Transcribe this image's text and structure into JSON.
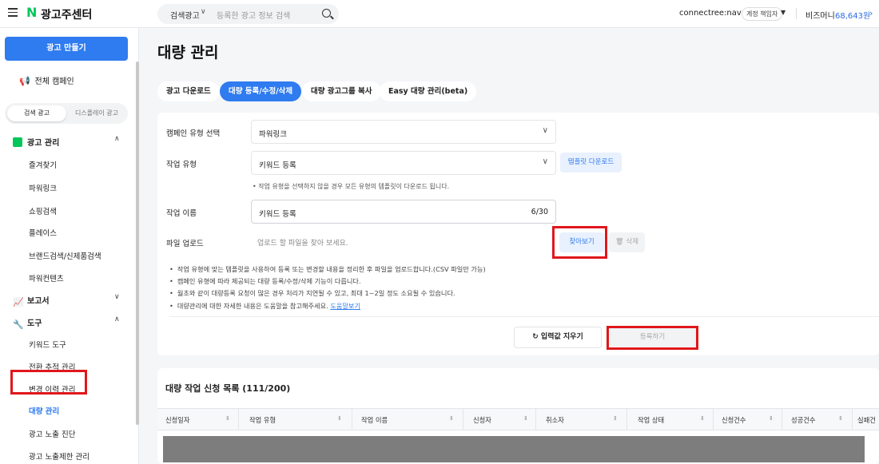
{
  "topbar": {
    "brand": "광고주센터",
    "search_type": "검색광고",
    "search_placeholder": "등록한 광고 정보 검색",
    "account": "connectree:naver",
    "account_role": "계정 책임자",
    "bizmoney_label": "비즈머니",
    "bizmoney_value": "68,643원"
  },
  "sidebar": {
    "create_label": "광고 만들기",
    "all_campaigns": "전체 캠페인",
    "seg_search": "검색 광고",
    "seg_display": "디스플레이 광고",
    "group_ads": "광고 관리",
    "ads_items": [
      "즐겨찾기",
      "파워링크",
      "쇼핑검색",
      "플레이스",
      "브랜드검색/신제품검색",
      "파워컨텐츠"
    ],
    "group_report": "보고서",
    "group_tools": "도구",
    "tools_items": [
      "키워드 도구",
      "전환 추적 관리",
      "변경 이력 관리",
      "대량 관리",
      "광고 노출 진단",
      "광고 노출제한 관리"
    ]
  },
  "main": {
    "title": "대량 관리",
    "tabs": [
      "광고 다운로드",
      "대량 등록/수정/삭제",
      "대량 광고그룹 복사",
      "Easy 대량 관리(beta)"
    ],
    "form": {
      "campaign_type_label": "캠페인 유형 선택",
      "campaign_type_value": "파워링크",
      "job_type_label": "작업 유형",
      "job_type_value": "키워드 등록",
      "template_btn": "템플릿 다운로드",
      "job_type_hint": "•  작업 유형을 선택하지 않을 경우 모든 유형의 템플릿이 다운로드 됩니다.",
      "job_name_label": "작업 이름",
      "job_name_value": "키워드 등록",
      "job_name_count": "6/30",
      "upload_label": "파일 업로드",
      "upload_placeholder": "업로드 할 파일을 찾아 보세요.",
      "browse_btn": "찾아보기",
      "delete_btn": "삭제"
    },
    "notes": [
      "작업 유형에 맞는 템플릿을 사용하여 등록 또는 변경할 내용을 정리한 후 파일을 업로드합니다.(CSV 파일만 가능)",
      "캠페인 유형에 따라 제공되는 대량 등록/수정/삭제 기능이 다릅니다.",
      "월초와 같이 대량등록 요청이 많은 경우 처리가 지연될 수 있고, 최대 1~2일 정도 소요될 수 있습니다.",
      "대량관리에 대한 자세한 내용은 도움말을 참고해주세요."
    ],
    "help_link": "도움말보기",
    "clear_btn": "입력값 지우기",
    "submit_btn": "등록하기",
    "list_title": "대량 작업 신청 목록  (111/200)",
    "columns": [
      "신청일자",
      "작업 유형",
      "작업 이름",
      "신청자",
      "취소자",
      "작업 상태",
      "신청건수",
      "성공건수",
      "실패건"
    ]
  },
  "colors": {
    "accent": "#2f7bf0",
    "highlight": "#e0171c",
    "naver_green": "#03c75a"
  }
}
